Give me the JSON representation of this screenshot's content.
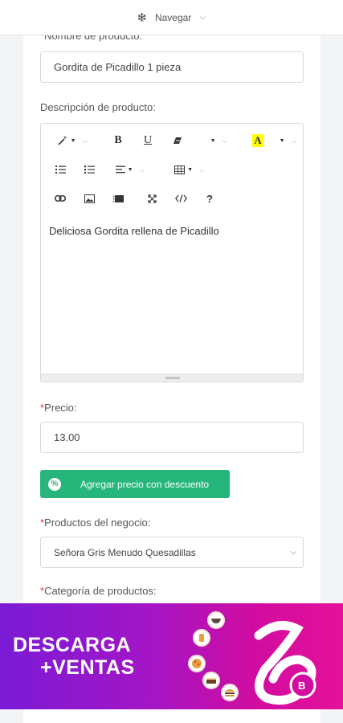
{
  "topbar": {
    "nav_label": "Navegar"
  },
  "form": {
    "product_name": {
      "label": "*Nombre de producto:",
      "value": "Gordita de Picadillo 1 pieza"
    },
    "description": {
      "label": "Descripción de producto:",
      "content": "Deliciosa Gordita rellena de Picadillo",
      "toolbar_bold": "B",
      "toolbar_underline": "U",
      "toolbar_highlight": "A",
      "toolbar_help": "?"
    },
    "price": {
      "required_mark": "*",
      "label": "Precio:",
      "value": "13.00"
    },
    "discount_button": {
      "label": "Agregar precio con descuento",
      "icon_text": "%"
    },
    "business_products": {
      "required_mark": "*",
      "label": "Productos del negocio:",
      "selected": "Señora Gris Menudo Quesadillas"
    },
    "category": {
      "required_mark": "*",
      "label": "Categoría de productos:"
    }
  },
  "banner": {
    "line1": "DESCARGA",
    "line2": "+VENTAS",
    "badge_letter": "B"
  },
  "colors": {
    "accent_green": "#26b67c",
    "required_red": "#e53935",
    "banner_purple": "#7b1bd6",
    "banner_pink": "#e5119a"
  },
  "icons": [
    "snowflake-icon",
    "chevron-down-icon",
    "magic-wand-icon",
    "bold-icon",
    "underline-icon",
    "eraser-icon",
    "font-color-icon",
    "bulleted-list-icon",
    "numbered-list-icon",
    "align-icon",
    "table-icon",
    "link-icon",
    "image-icon",
    "video-icon",
    "fullscreen-icon",
    "code-view-icon",
    "help-icon",
    "percent-icon"
  ]
}
